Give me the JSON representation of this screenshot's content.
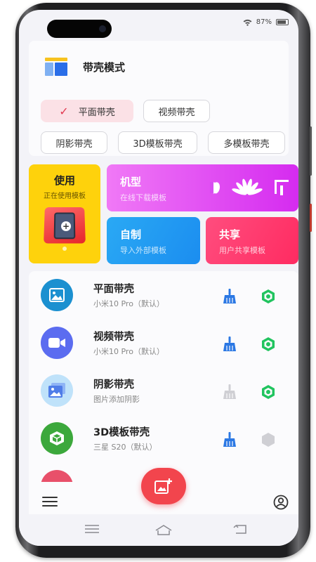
{
  "status": {
    "battery": "87%"
  },
  "mode_card": {
    "title": "带壳模式",
    "chips": [
      {
        "label": "平面带壳",
        "selected": true
      },
      {
        "label": "视频带壳",
        "selected": false
      },
      {
        "label": "阴影带壳",
        "selected": false
      },
      {
        "label": "3D模板带壳",
        "selected": false
      },
      {
        "label": "多模板带壳",
        "selected": false
      }
    ],
    "check_glyph": "✓"
  },
  "tiles": {
    "use": {
      "title": "使用",
      "subtitle": "正在使用模板"
    },
    "model": {
      "title": "机型",
      "subtitle": "在线下载模板",
      "brand_icons": [
        "apple-icon",
        "huawei-icon",
        "xiaomi-icon"
      ]
    },
    "diy": {
      "title": "自制",
      "subtitle": "导入外部模板"
    },
    "share": {
      "title": "共享",
      "subtitle": "用户共享模板"
    }
  },
  "list": [
    {
      "title": "平面带壳",
      "subtitle": "小米10 Pro（默认）",
      "icon": "image-icon",
      "color": "#1b90d0",
      "clean_enabled": true,
      "settings_enabled": true
    },
    {
      "title": "视频带壳",
      "subtitle": "小米10 Pro（默认）",
      "icon": "video-icon",
      "color": "#5b6cf0",
      "clean_enabled": true,
      "settings_enabled": true
    },
    {
      "title": "阴影带壳",
      "subtitle": "图片添加阴影",
      "icon": "gallery-icon",
      "color": "#bfe2fa",
      "clean_enabled": false,
      "settings_enabled": true
    },
    {
      "title": "3D模板带壳",
      "subtitle": "三星 S20（默认）",
      "icon": "cube-icon",
      "color": "#3ca83c",
      "clean_enabled": true,
      "settings_enabled": false
    }
  ],
  "colors": {
    "accent_red": "#f2454d",
    "clean_blue": "#2b78e4",
    "hex_green": "#21c45f",
    "disabled_gray": "#cfcfd4"
  }
}
